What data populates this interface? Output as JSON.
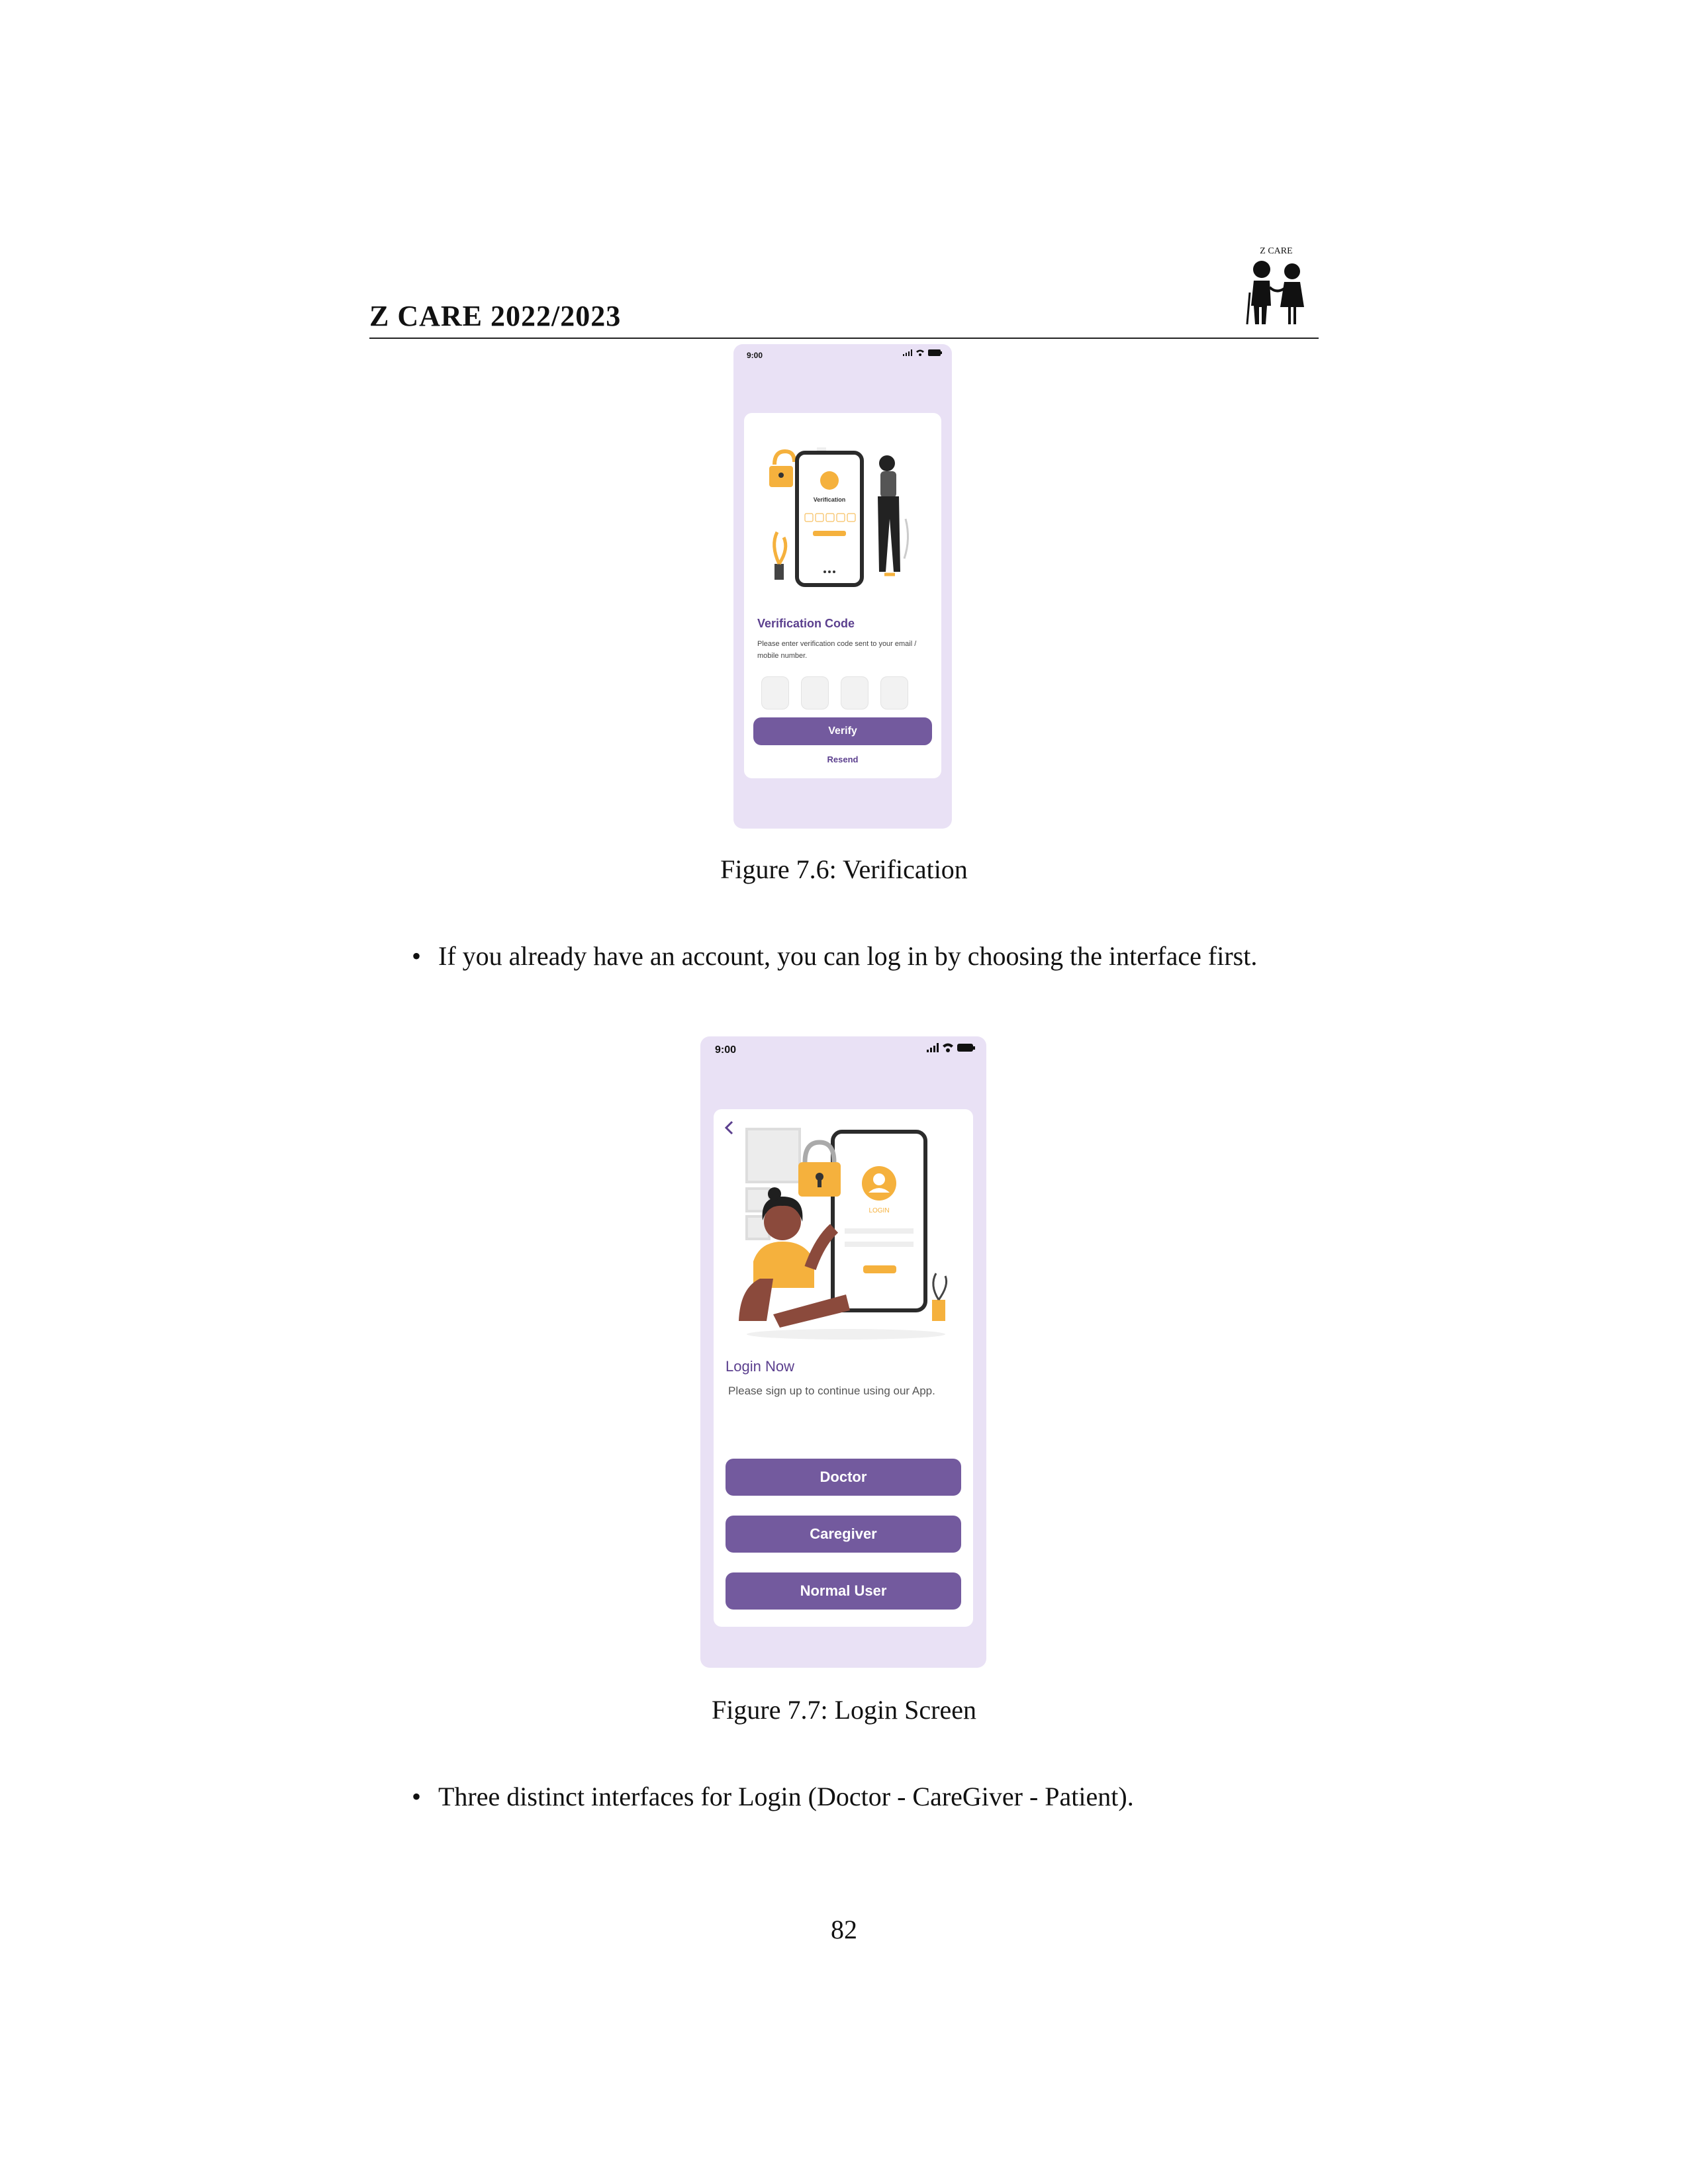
{
  "header": {
    "title": "Z CARE 2022/2023",
    "logo_text": "Z CARE"
  },
  "figure1": {
    "status_time": "9:00",
    "illustration_title": "Verification",
    "title": "Verification Code",
    "description": "Please enter verification code sent to your email / mobile number.",
    "verify_label": "Verify",
    "resend_label": "Resend",
    "caption": "Figure 7.6: Verification"
  },
  "bullet1": "If you already have an account, you can log in by choosing the interface first.",
  "figure2": {
    "status_time": "9:00",
    "illustration_title": "LOGIN",
    "title": "Login Now",
    "description": "Please sign up to continue using our App.",
    "buttons": [
      "Doctor",
      "Caregiver",
      "Normal User"
    ],
    "caption": "Figure 7.7: Login Screen"
  },
  "bullet2": "Three distinct interfaces for Login (Doctor - CareGiver - Patient).",
  "page_number": "82",
  "colors": {
    "accent": "#735a9e",
    "phone_bg": "#e9e1f5",
    "illustration_yellow": "#f5b13d"
  }
}
